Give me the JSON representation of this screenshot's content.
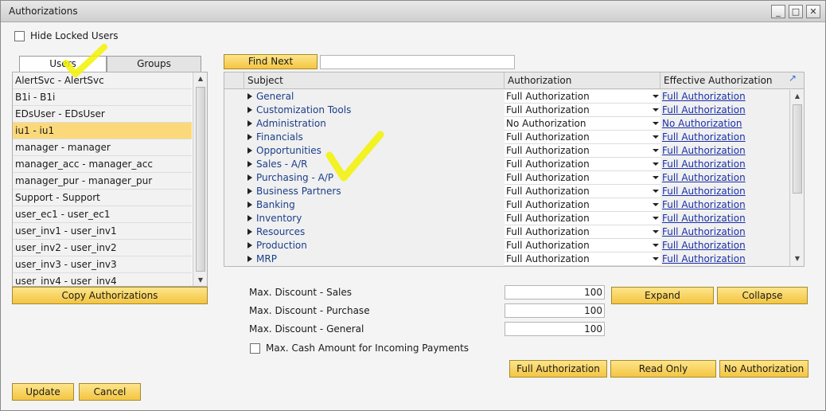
{
  "window": {
    "title": "Authorizations",
    "controls": {
      "minimize": "_",
      "maximize": "□",
      "close": "✕"
    }
  },
  "hide_locked": {
    "label": "Hide Locked Users",
    "checked": false
  },
  "tabs": [
    {
      "label": "Users",
      "active": true
    },
    {
      "label": "Groups",
      "active": false
    }
  ],
  "users": [
    "AlertSvc - AlertSvc",
    "B1i - B1i",
    "EDsUser - EDsUser",
    "iu1 - iu1",
    "manager - manager",
    "manager_acc - manager_acc",
    "manager_pur - manager_pur",
    "Support - Support",
    "user_ec1 - user_ec1",
    "user_inv1 - user_inv1",
    "user_inv2 - user_inv2",
    "user_inv3 - user_inv3",
    "user_inv4 - user_inv4"
  ],
  "selected_user": "iu1 - iu1",
  "copy_button": "Copy Authorizations",
  "find_next": {
    "label": "Find Next",
    "value": ""
  },
  "grid": {
    "columns": [
      "Subject",
      "Authorization",
      "Effective Authorization"
    ],
    "rows": [
      {
        "subject": "General",
        "auth": "Full Authorization",
        "effective": "Full Authorization"
      },
      {
        "subject": "Customization Tools",
        "auth": "Full Authorization",
        "effective": "Full Authorization"
      },
      {
        "subject": "Administration",
        "auth": "No Authorization",
        "effective": "No Authorization"
      },
      {
        "subject": "Financials",
        "auth": "Full Authorization",
        "effective": "Full Authorization"
      },
      {
        "subject": "Opportunities",
        "auth": "Full Authorization",
        "effective": "Full Authorization"
      },
      {
        "subject": "Sales - A/R",
        "auth": "Full Authorization",
        "effective": "Full Authorization"
      },
      {
        "subject": "Purchasing - A/P",
        "auth": "Full Authorization",
        "effective": "Full Authorization"
      },
      {
        "subject": "Business Partners",
        "auth": "Full Authorization",
        "effective": "Full Authorization"
      },
      {
        "subject": "Banking",
        "auth": "Full Authorization",
        "effective": "Full Authorization"
      },
      {
        "subject": "Inventory",
        "auth": "Full Authorization",
        "effective": "Full Authorization"
      },
      {
        "subject": "Resources",
        "auth": "Full Authorization",
        "effective": "Full Authorization"
      },
      {
        "subject": "Production",
        "auth": "Full Authorization",
        "effective": "Full Authorization"
      },
      {
        "subject": "MRP",
        "auth": "Full Authorization",
        "effective": "Full Authorization"
      }
    ]
  },
  "discounts": [
    {
      "label": "Max. Discount - Sales",
      "value": "100"
    },
    {
      "label": "Max. Discount - Purchase",
      "value": "100"
    },
    {
      "label": "Max. Discount - General",
      "value": "100"
    }
  ],
  "cash": {
    "label": "Max. Cash Amount for Incoming Payments",
    "checked": false
  },
  "buttons": {
    "expand": "Expand",
    "collapse": "Collapse",
    "full_auth": "Full Authorization",
    "read_only": "Read Only",
    "no_auth": "No Authorization",
    "update": "Update",
    "cancel": "Cancel"
  },
  "colors": {
    "accent_yellow": "#f4c542",
    "selection": "#fbd97a",
    "link": "#1a2fa8",
    "highlight_mark": "#f2f200"
  }
}
